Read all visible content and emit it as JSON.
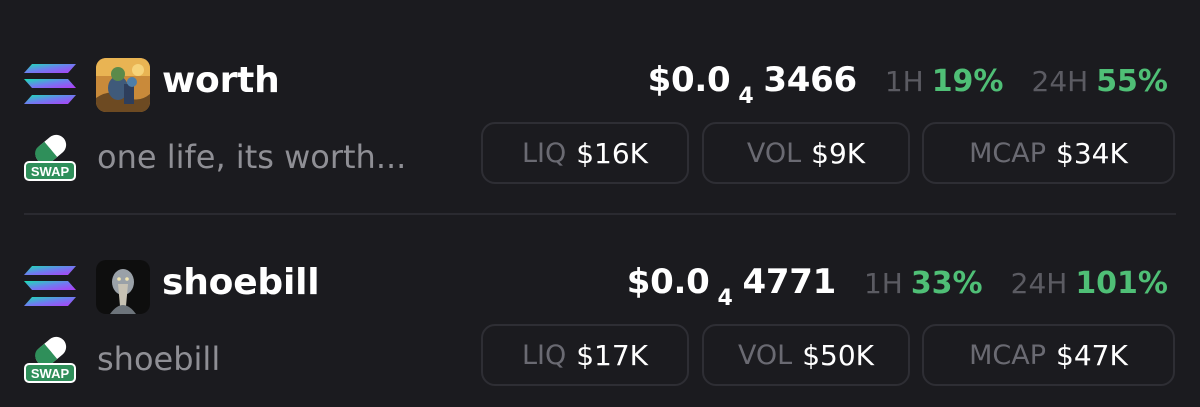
{
  "tokens": [
    {
      "symbol": "worth",
      "name": "one life, its worth...",
      "price": {
        "prefix": "$0.0",
        "zeros": "4",
        "digits": "3466"
      },
      "changes": [
        {
          "label": "1H",
          "value": "19%"
        },
        {
          "label": "24H",
          "value": "55%"
        }
      ],
      "stats": [
        {
          "label": "LIQ",
          "value": "$16K"
        },
        {
          "label": "VOL",
          "value": "$9K"
        },
        {
          "label": "MCAP",
          "value": "$34K"
        }
      ],
      "swap_label": "SWAP"
    },
    {
      "symbol": "shoebill",
      "name": "shoebill",
      "price": {
        "prefix": "$0.0",
        "zeros": "4",
        "digits": "4771"
      },
      "changes": [
        {
          "label": "1H",
          "value": "33%"
        },
        {
          "label": "24H",
          "value": "101%"
        }
      ],
      "stats": [
        {
          "label": "LIQ",
          "value": "$17K"
        },
        {
          "label": "VOL",
          "value": "$50K"
        },
        {
          "label": "MCAP",
          "value": "$47K"
        }
      ],
      "swap_label": "SWAP"
    }
  ],
  "icons": {
    "chain": "solana-icon",
    "swap": "swap-pill-icon",
    "avatars": [
      "worth-avatar",
      "shoebill-avatar"
    ]
  },
  "colors": {
    "background": "#1b1b1f",
    "positive_change": "#4fbf76",
    "muted_text": "#8f8f95",
    "box_border": "#2e2e34",
    "swap_green": "#2f8f5a"
  }
}
